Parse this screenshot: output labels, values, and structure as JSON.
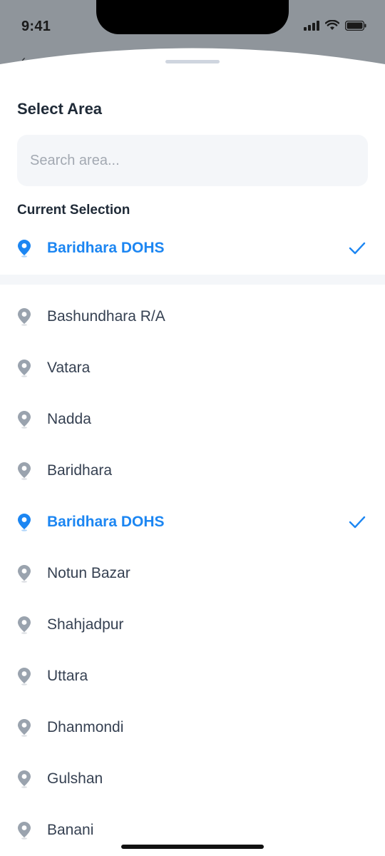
{
  "status_bar": {
    "time": "9:41"
  },
  "sheet": {
    "title": "Select Area",
    "search": {
      "placeholder": "Search area...",
      "value": ""
    },
    "current_selection": {
      "label": "Current Selection",
      "value": "Baridhara DOHS"
    },
    "areas": [
      {
        "name": "Bashundhara R/A",
        "selected": false
      },
      {
        "name": "Vatara",
        "selected": false
      },
      {
        "name": "Nadda",
        "selected": false
      },
      {
        "name": "Baridhara",
        "selected": false
      },
      {
        "name": "Baridhara DOHS",
        "selected": true
      },
      {
        "name": "Notun Bazar",
        "selected": false
      },
      {
        "name": "Shahjadpur",
        "selected": false
      },
      {
        "name": "Uttara",
        "selected": false
      },
      {
        "name": "Dhanmondi",
        "selected": false
      },
      {
        "name": "Gulshan",
        "selected": false
      },
      {
        "name": "Banani",
        "selected": false
      }
    ]
  },
  "icons": {
    "area": "location-pin-icon",
    "selected": "checkmark-icon"
  },
  "colors": {
    "accent": "#1c86f2",
    "pin_default": "#9aa3ae",
    "text": "#364152",
    "title": "#1f2a37"
  }
}
